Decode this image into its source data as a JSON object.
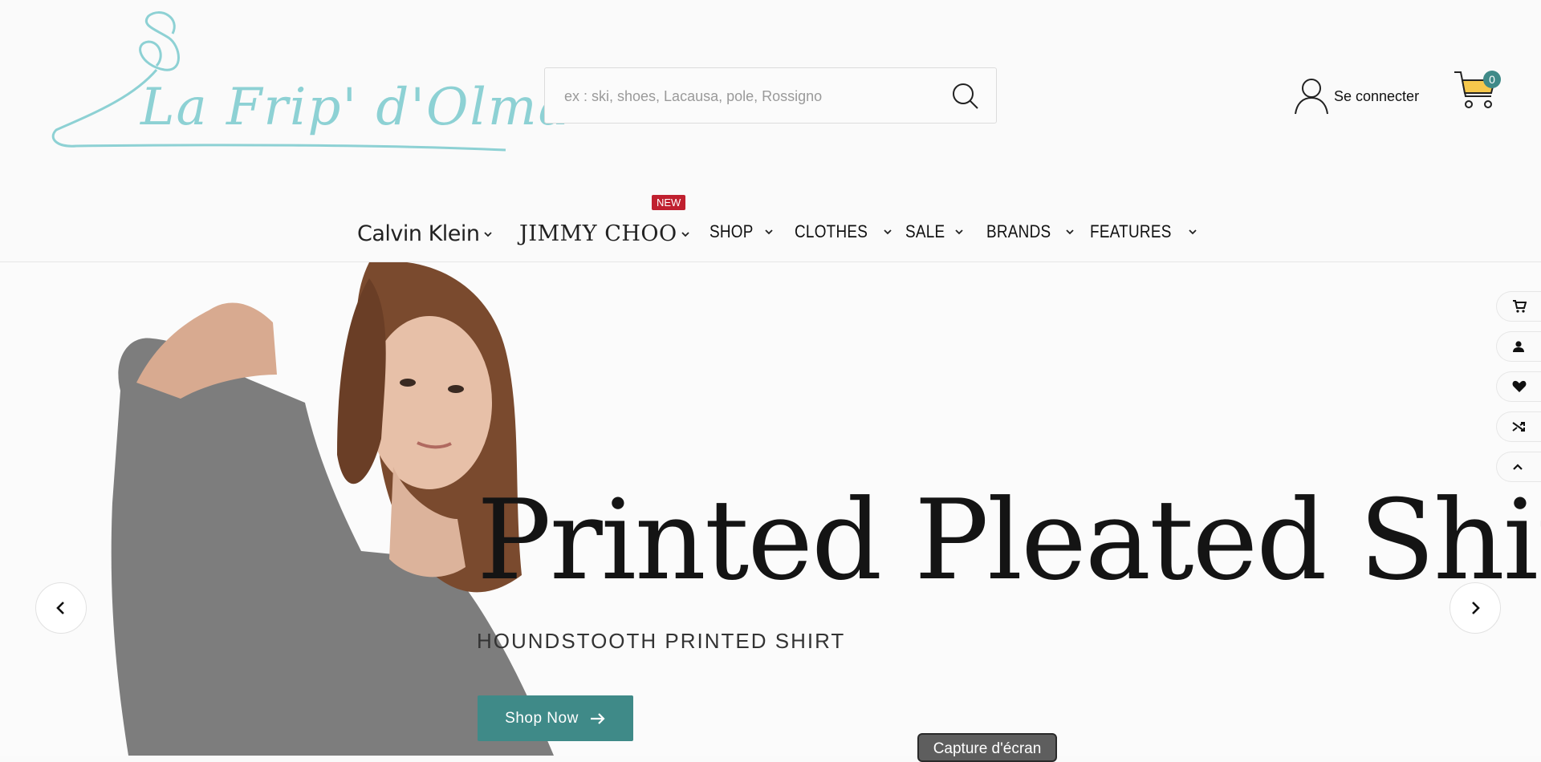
{
  "logo": {
    "text": "La Frip' d'Olma",
    "color": "#8dd1d4"
  },
  "search": {
    "placeholder": "ex : ski, shoes, Lacausa, pole, Rossigno",
    "icon": "search-icon"
  },
  "account": {
    "label": "Se connecter",
    "icon": "user-icon"
  },
  "cart": {
    "count": "0",
    "icon": "cart-icon",
    "badge_color": "#3f8a88",
    "basket_color": "#f6c84c"
  },
  "nav": {
    "items": [
      {
        "label": "Calvin Klein"
      },
      {
        "label": "JIMMY CHOO",
        "badge": "NEW"
      },
      {
        "label": "SHOP"
      },
      {
        "label": "CLOTHES"
      },
      {
        "label": "SALE"
      },
      {
        "label": "BRANDS"
      },
      {
        "label": "FEATURES"
      }
    ]
  },
  "hero": {
    "title": "Printed Pleated Shirt",
    "subtitle": "HOUNDSTOOTH PRINTED SHIRT",
    "cta": "Shop Now",
    "accent": "#3f8a88"
  },
  "sidebar": {
    "buttons": [
      {
        "icon": "cart-icon"
      },
      {
        "icon": "user-icon"
      },
      {
        "icon": "heart-icon"
      },
      {
        "icon": "shuffle-icon"
      },
      {
        "icon": "chevron-up-icon"
      }
    ]
  },
  "os_tooltip": {
    "label": "Capture d'écran"
  }
}
